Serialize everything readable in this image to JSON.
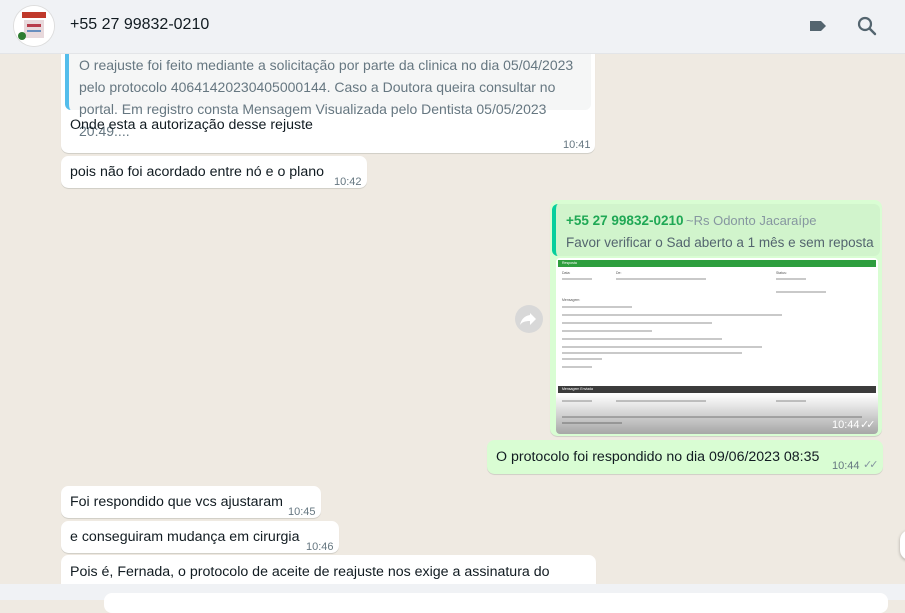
{
  "header": {
    "contact_name": "+55 27 99832-0210",
    "icons": [
      "label-icon",
      "search-icon"
    ]
  },
  "messages": {
    "m1": {
      "quote_text": "O reajuste foi feito mediante a solicitação por parte da clinica no dia 05/04/2023 pelo protocolo 40641420230405000144. Caso a Doutora queira consultar no portal. Em registro consta Mensagem Visualizada pelo Dentista 05/05/2023 20:49....",
      "text": "Onde esta a autorização desse rejuste",
      "time": "10:41"
    },
    "m2": {
      "text": "pois não foi acordado entre nó e o plano",
      "time": "10:42"
    },
    "m3": {
      "reply_author": "+55 27 99832-0210",
      "reply_author_alias": "~Rs Odonto Jacaraípe",
      "reply_text": "Favor verificar o Sad aberto a 1 mês  e sem reposta",
      "time": "10:44",
      "doc": {
        "section1": "Resposta",
        "section2": "Mensagem Enviada",
        "lines": [
          "Data:",
          "De:",
          "Status:",
          "Mensagem:",
          "Boa Tarde,",
          "Envios:"
        ]
      }
    },
    "m4": {
      "text": "O protocolo foi respondido no dia 09/06/2023 08:35",
      "time": "10:44"
    },
    "m5": {
      "text": "Foi respondido que vcs ajustaram",
      "time": "10:45"
    },
    "m6": {
      "text": "e conseguiram mudança em cirurgia",
      "time": "10:46"
    },
    "m7": {
      "text": "Pois é, Fernada, o protocolo de aceite de reajuste nos exige a assinatura do"
    }
  },
  "colors": {
    "incoming": "#ffffff",
    "outgoing": "#d9fdd3",
    "accent_green": "#1fa855",
    "quote_bar": "#53bdeb"
  }
}
